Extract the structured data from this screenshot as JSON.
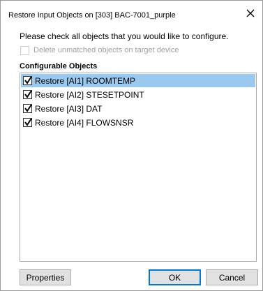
{
  "window": {
    "title": "Restore Input Objects on [303] BAC-7001_purple",
    "close_icon": "close-icon"
  },
  "instruction": "Please check all objects that you would like to configure.",
  "delete_option": {
    "label": "Delete unmatched objects on target device",
    "checked": false,
    "enabled": false
  },
  "section_label": "Configurable Objects",
  "objects": [
    {
      "label": "Restore [AI1] ROOMTEMP",
      "checked": true,
      "selected": true
    },
    {
      "label": "Restore [AI2] STESETPOINT",
      "checked": true,
      "selected": false
    },
    {
      "label": "Restore [AI3] DAT",
      "checked": true,
      "selected": false
    },
    {
      "label": "Restore [AI4] FLOWSNSR",
      "checked": true,
      "selected": false
    }
  ],
  "buttons": {
    "properties": "Properties",
    "ok": "OK",
    "cancel": "Cancel"
  },
  "colors": {
    "selection": "#99c9ef",
    "default_button_border": "#0078d7",
    "button_face": "#e1e1e1"
  }
}
